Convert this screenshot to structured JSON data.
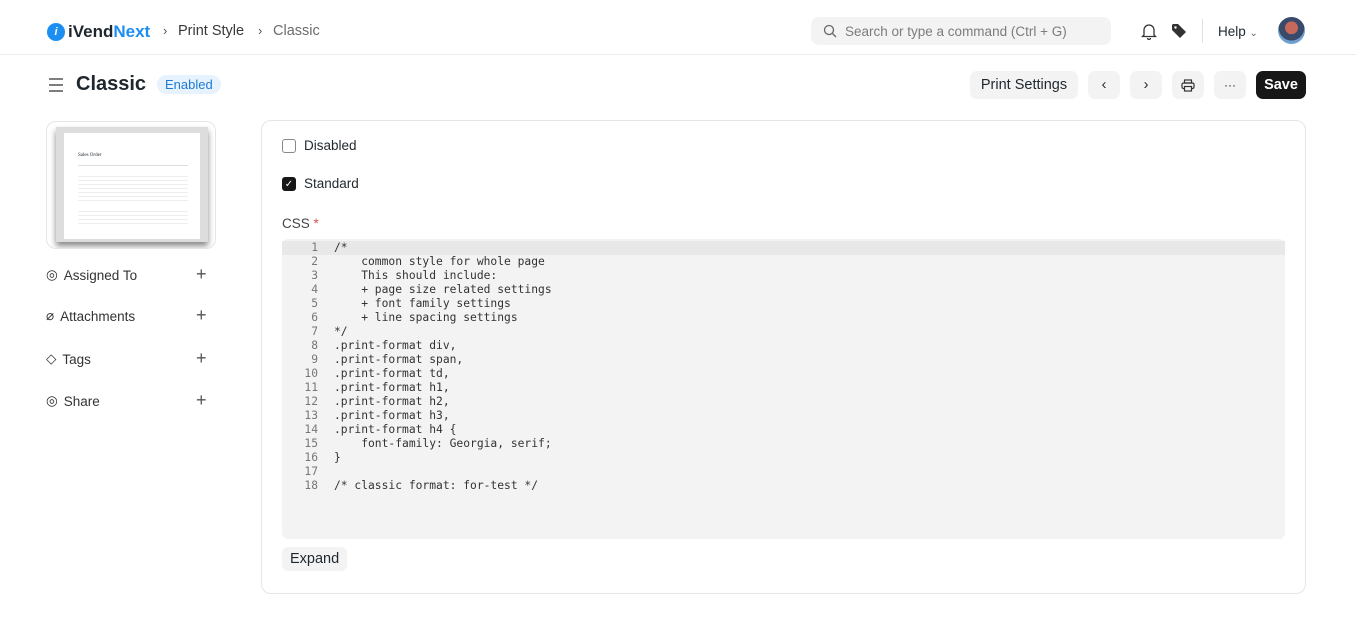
{
  "nav": {
    "logo_a": "iVend",
    "logo_b": "Next",
    "breadcrumbs": [
      "Print Style",
      "Classic"
    ],
    "search_placeholder": "Search or type a command (Ctrl + G)",
    "help": "Help"
  },
  "header": {
    "title": "Classic",
    "status": "Enabled",
    "print_settings": "Print Settings",
    "save": "Save"
  },
  "sidebar": {
    "items": [
      {
        "label": "Assigned To",
        "icon": "user-plus-icon"
      },
      {
        "label": "Attachments",
        "icon": "paperclip-icon"
      },
      {
        "label": "Tags",
        "icon": "tag-icon"
      },
      {
        "label": "Share",
        "icon": "share-user-icon"
      }
    ],
    "preview_title": "Sales Order"
  },
  "form": {
    "disabled_label": "Disabled",
    "disabled_checked": false,
    "standard_label": "Standard",
    "standard_checked": true,
    "css_label": "CSS",
    "required_mark": "*",
    "expand": "Expand",
    "code": [
      "/*",
      "    common style for whole page",
      "    This should include:",
      "    + page size related settings",
      "    + font family settings",
      "    + line spacing settings",
      "*/",
      ".print-format div,",
      ".print-format span,",
      ".print-format td,",
      ".print-format h1,",
      ".print-format h2,",
      ".print-format h3,",
      ".print-format h4 {",
      "    font-family: Georgia, serif;",
      "}",
      "",
      "/* classic format: for-test */"
    ]
  }
}
